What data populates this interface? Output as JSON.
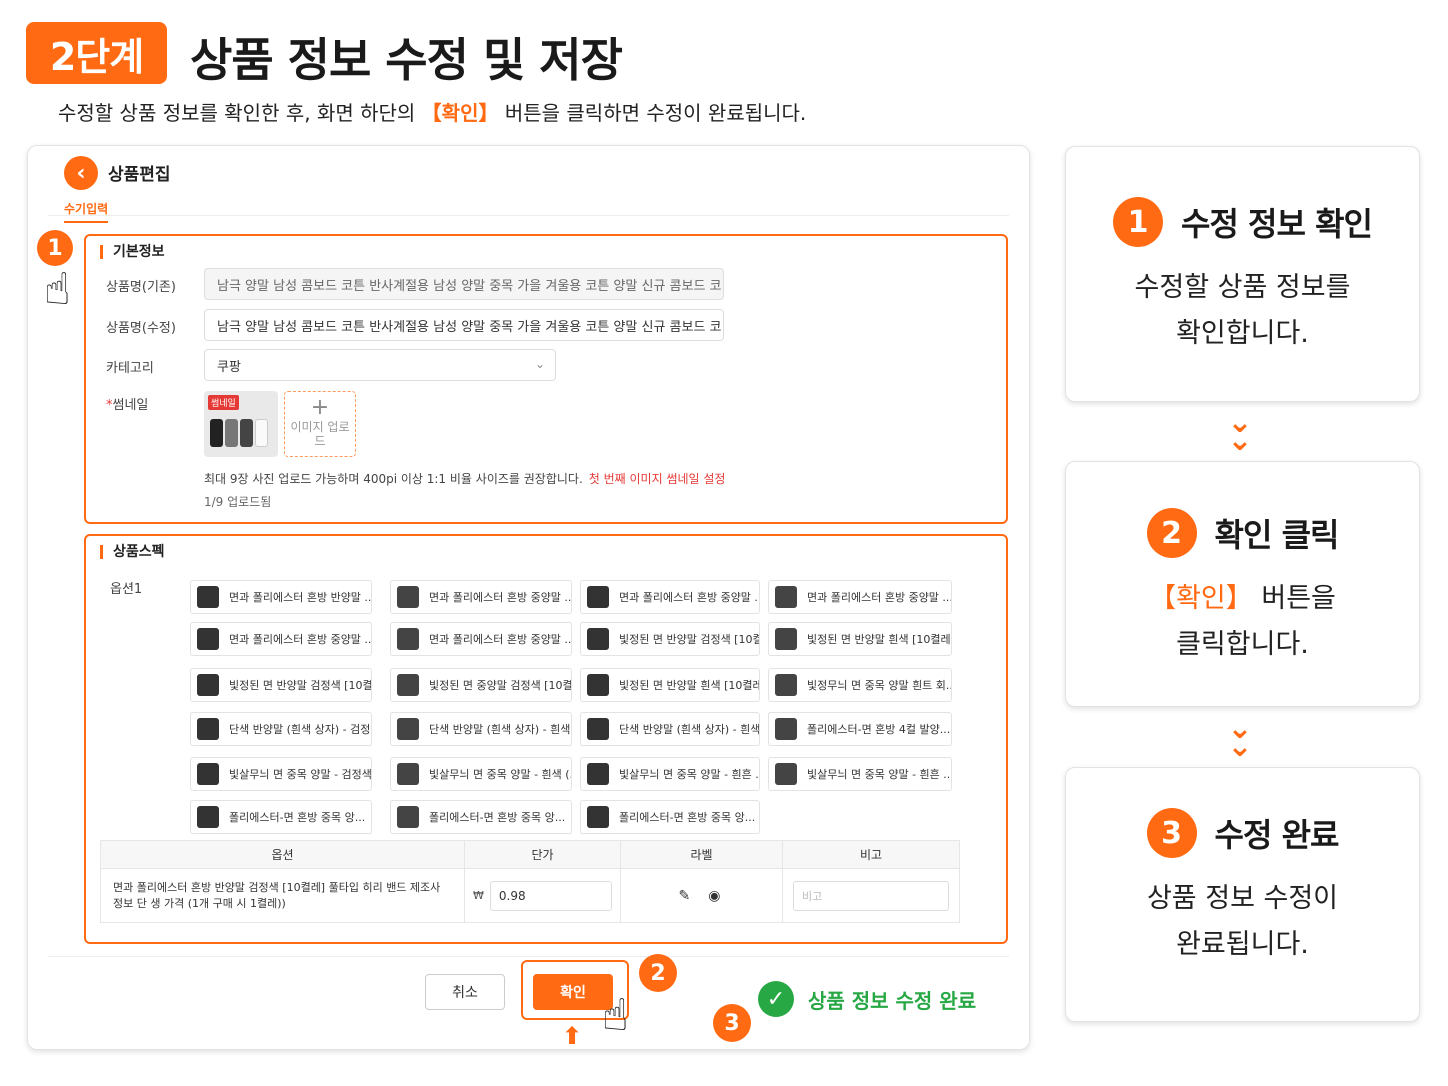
{
  "header": {
    "step": "2단계",
    "title": "상품 정보 수정 및 저장",
    "desc_before": "수정할 상품 정보를 확인한 후, 화면 하단의 ",
    "desc_highlight": "【확인】",
    "desc_after": " 버튼을 클릭하면 수정이 완료됩니다."
  },
  "panel": {
    "title": "상품편집",
    "tab": "수기입력",
    "basic": {
      "heading": "기본정보",
      "label_name_orig": "상품명(기존)",
      "name_orig": "남극 양말 남성 콤보드 코튼 반사계절용 남성 양말 중목 가을 겨울용 코튼 양말 신규 콤보드 코",
      "label_name_edit": "상품명(수정)",
      "name_edit": "남극 양말 남성 콤보드 코튼 반사계절용 남성 양말 중목 가을 겨울용 코튼 양말 신규 콤보드 코",
      "label_category": "카테고리",
      "category": "쿠팡",
      "label_thumb_req": "*",
      "label_thumb": "썸네일",
      "thumb_tag": "썸네일",
      "upload_label": "이미지 업로드",
      "hint": "최대 9장 사진 업로드 가능하며 400pi 이상 1:1 비율 사이즈를 권장합니다.",
      "hint_link": "첫 번째 이미지 썸네일 설정",
      "count": "1/9 업로드됨"
    },
    "spec": {
      "heading": "상품스펙",
      "option_label": "옵션1",
      "chips": [
        "면과 폴리에스터 혼방 반양말 ...",
        "면과 폴리에스터 혼방 중양말 ...",
        "면과 폴리에스터 혼방 중양말 ...",
        "면과 폴리에스터 혼방 중양말 ...",
        "면과 폴리에스터 혼방 중양말 ...",
        "면과 폴리에스터 혼방 중양말 ...",
        "빛정된 면 반양말 검정색 [10켤:",
        "빛정된 면 반양말 흰색 [10켤레...",
        "빛정된 면 반양말 검정색 [10켤2...",
        "빛정된 면 중양말 검정색 [10켤:",
        "빛정된 면 반양말 흰색 [10켤레...",
        "빛정무늬 면 중목 양말 흰트 회...",
        "단색 반양말 (흰색 상자) - 검정...",
        "단색 반양말 (흰색 상자) - 흰색...",
        "단색 반양말 (흰색 상자) - 흰색...",
        "폴리에스터-면 혼방 4컬 발양...",
        "빛살무늬 면 중목 양말 - 검정색...",
        "빛살무늬 면 중목 양말 - 흰색 (...",
        "빛살무늬 면 중목 양말 - 흰흔 ...",
        "빛살무늬 면 중목 양말 - 흰흔 ...",
        "폴리에스터-면 혼방 중목 앙...",
        "폴리에스터-면 혼방 중목 앙...",
        "폴리에스터-면 혼방 중목 앙..."
      ],
      "table": {
        "headers": [
          "옵션",
          "단가",
          "라벨",
          "비고"
        ],
        "row_option_line1": "면과 폴리에스터 혼방 반양말 검정색 [10켤레] 풀타입 히리 밴드 제조사",
        "row_option_line2": "정보 단 생 가격 (1개 구매 시 1켤레))",
        "currency": "₩",
        "price": "0.98",
        "note_placeholder": "비고"
      }
    },
    "buttons": {
      "cancel": "취소",
      "confirm": "확인"
    },
    "done_text": "상품 정보 수정 완료",
    "markers": [
      "1",
      "2",
      "3"
    ]
  },
  "cards": [
    {
      "num": "1",
      "title": "수정 정보 확인",
      "line1": "수정할 상품 정보를",
      "line2": "확인합니다.",
      "line1_hl": ""
    },
    {
      "num": "2",
      "title": "확인 클릭",
      "line1_hl": "【확인】",
      "line1": " 버튼을",
      "line2": "클릭합니다."
    },
    {
      "num": "3",
      "title": "수정 완료",
      "line1": "상품 정보 수정이",
      "line2": "완료됩니다.",
      "line1_hl": ""
    }
  ],
  "colors": {
    "accent": "#ff6a13",
    "success": "#27a844",
    "danger": "#e53935"
  }
}
